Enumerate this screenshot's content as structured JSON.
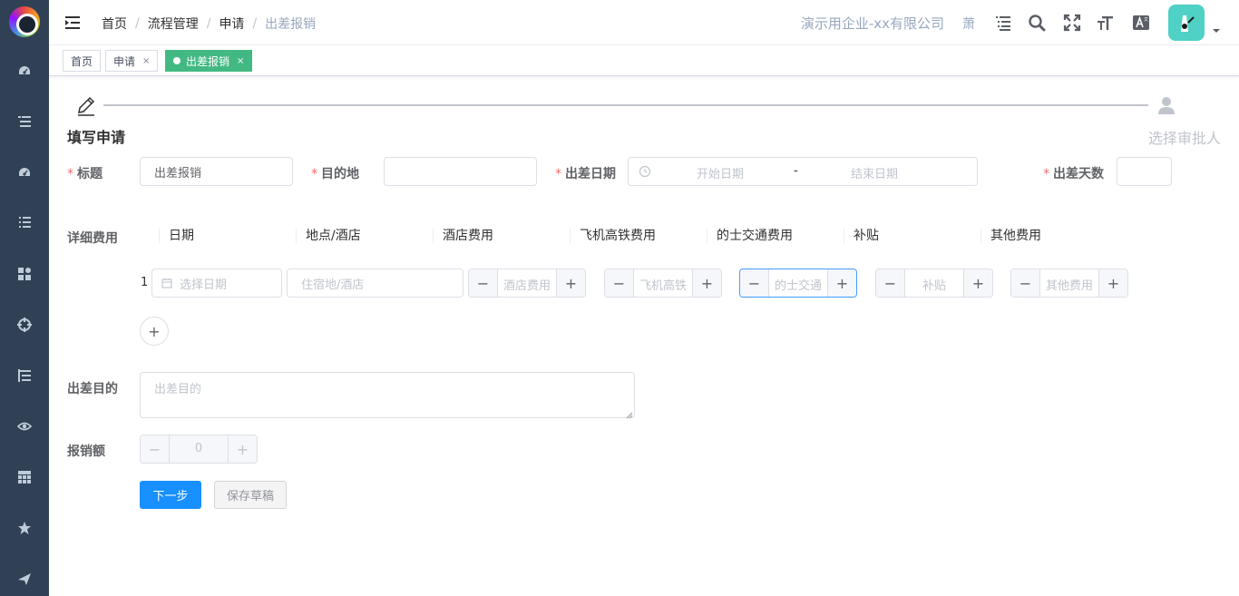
{
  "colors": {
    "sidebar": "#304156",
    "tag_active": "#42b983",
    "primary": "#1890ff",
    "required": "#f56c6c"
  },
  "icons": {
    "sidebar": [
      "dashboard-icon",
      "list-icon",
      "dashboard-icon",
      "list-icon",
      "grid-icon",
      "target-icon",
      "tree-list-icon",
      "eye-icon",
      "table-icon",
      "star-icon",
      "send-icon"
    ],
    "navbar": [
      "hamburger-icon",
      "list-search-icon",
      "search-icon",
      "fullscreen-icon",
      "font-size-icon",
      "translate-icon"
    ]
  },
  "breadcrumb": [
    "首页",
    "流程管理",
    "申请",
    "出差报销"
  ],
  "header": {
    "company": "演示用企业-xx有限公司",
    "user_short": "萧"
  },
  "tags": [
    {
      "label": "首页"
    },
    {
      "label": "申请",
      "close": "×"
    },
    {
      "label": "出差报销",
      "close": "×"
    }
  ],
  "steps": {
    "step1": "填写申请",
    "step2": "选择审批人"
  },
  "form": {
    "title_label": "标题",
    "title_value": "出差报销",
    "destination_label": "目的地",
    "destination_value": "",
    "date_label": "出差日期",
    "start_placeholder": "开始日期",
    "range_sep": "-",
    "end_placeholder": "结束日期",
    "days_label": "出差天数",
    "days_value": "",
    "detail_label": "详细费用",
    "columns": [
      "日期",
      "地点/酒店",
      "酒店费用",
      "飞机高铁费用",
      "的士交通费用",
      "补贴",
      "其他费用"
    ],
    "row_index": "1",
    "row": {
      "date_placeholder": "选择日期",
      "place_placeholder": "住宿地/酒店",
      "hotel_placeholder": "酒店费用",
      "flight_placeholder": "飞机高铁",
      "taxi_placeholder": "的士交通",
      "subsidy_placeholder": "补贴",
      "other_placeholder": "其他费用"
    },
    "add_row": "+",
    "purpose_label": "出差目的",
    "purpose_placeholder": "出差目的",
    "amount_label": "报销额",
    "amount_value": "0",
    "stepper_minus": "−",
    "stepper_plus": "+",
    "next_button": "下一步",
    "draft_button": "保存草稿"
  }
}
